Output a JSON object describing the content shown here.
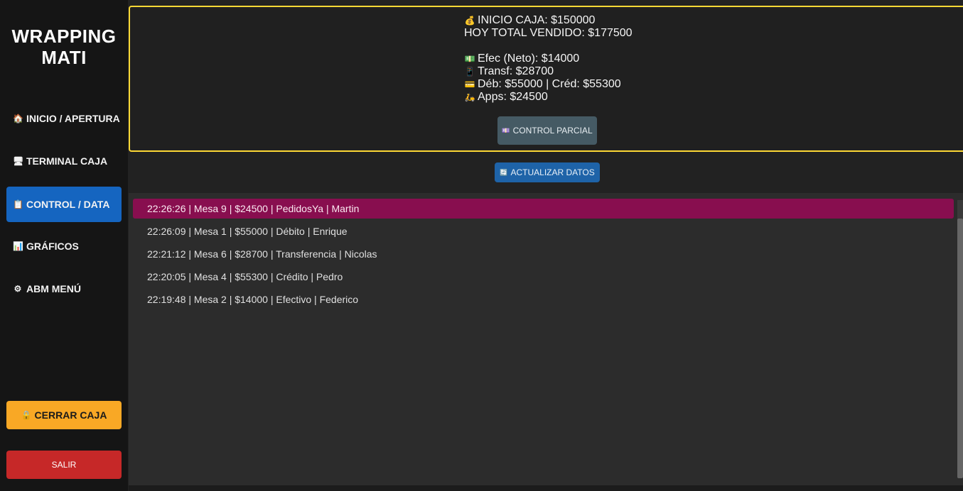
{
  "brand": {
    "line1": "WRAPPING",
    "line2": "MATI"
  },
  "sidebar": {
    "items": [
      {
        "icon": "🏠",
        "label": "INICIO / APERTURA"
      },
      {
        "icon": "🖥",
        "label": "TERMINAL CAJA"
      },
      {
        "icon": "📋",
        "label": "CONTROL / DATA"
      },
      {
        "icon": "📊",
        "label": "GRÁFICOS"
      },
      {
        "icon": "⚙",
        "label": "ABM MENÚ"
      }
    ],
    "close_register": {
      "icon": "🔒",
      "label": "CERRAR CAJA"
    },
    "exit_label": "SALIR"
  },
  "summary": {
    "opening": {
      "icon": "💰",
      "text": "INICIO CAJA: $150000"
    },
    "total_sold": "HOY TOTAL VENDIDO: $177500",
    "cash": {
      "icon": "💵",
      "text": "Efec (Neto): $14000"
    },
    "transfer": {
      "icon": "📱",
      "text": "Transf: $28700"
    },
    "cards": {
      "icon": "💳",
      "text": "Déb: $55000 | Créd: $55300"
    },
    "apps": {
      "icon": "🛵",
      "text": "Apps: $24500"
    },
    "partial_button": {
      "icon": "💷",
      "label": "CONTROL PARCIAL"
    }
  },
  "refresh_button": {
    "icon": "🔄",
    "label": "ACTUALIZAR DATOS"
  },
  "log": [
    "22:26:26 | Mesa 9 | $24500 | PedidosYa | Martin",
    "22:26:09 | Mesa 1 | $55000 | Débito | Enrique",
    "22:21:12 | Mesa 6 | $28700 | Transferencia | Nicolas",
    "22:20:05 | Mesa 4 | $55300 | Crédito | Pedro",
    "22:19:48 | Mesa 2 | $14000 | Efectivo | Federico"
  ],
  "colors": {
    "active_nav": "#1565c0",
    "close_register": "#f9a825",
    "exit": "#c62828",
    "summary_border": "#fdd835",
    "highlight_row": "#880e4f",
    "refresh_button": "#1e63a8"
  }
}
